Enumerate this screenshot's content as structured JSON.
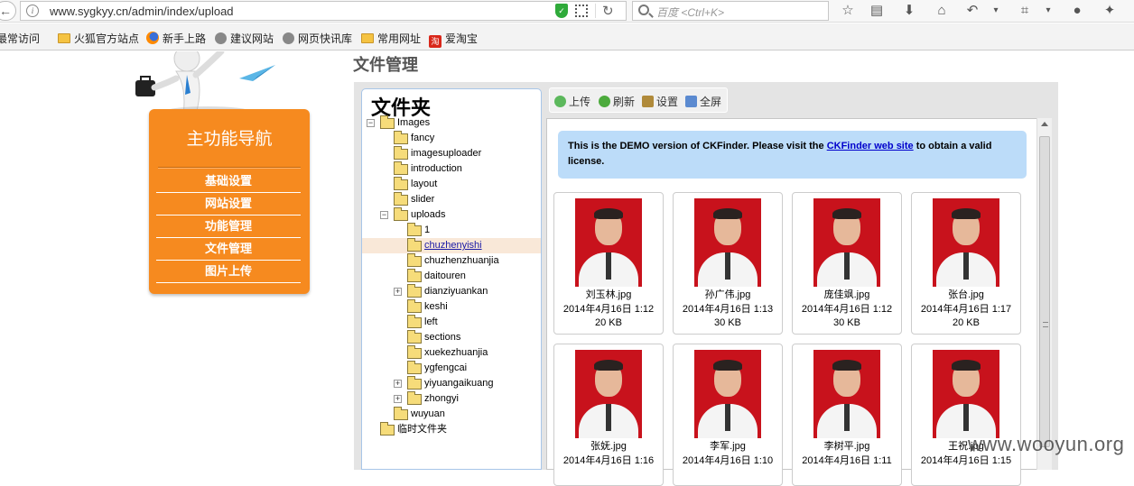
{
  "browser": {
    "url": "www.sygkyy.cn/admin/index/upload",
    "search_placeholder": "百度 <Ctrl+K>",
    "bookmarks": [
      "最常访问",
      "火狐官方站点",
      "新手上路",
      "建议网站",
      "网页快讯库",
      "常用网址",
      "爱淘宝"
    ]
  },
  "nav": {
    "title": "主功能导航",
    "items": [
      "基础设置",
      "网站设置",
      "功能管理",
      "文件管理",
      "图片上传"
    ]
  },
  "page": {
    "title": "文件管理"
  },
  "ckfinder": {
    "folders_heading": "文件夹",
    "toolbar": [
      "上传",
      "刷新",
      "设置",
      "全屏"
    ],
    "notice": {
      "before": "This is the DEMO version of CKFinder. Please visit the ",
      "link": "CKFinder web site",
      "after": " to obtain a valid license."
    },
    "tree": [
      {
        "label": "Images",
        "toggle": "−"
      },
      {
        "label": "fancy"
      },
      {
        "label": "imagesuploader"
      },
      {
        "label": "introduction"
      },
      {
        "label": "layout"
      },
      {
        "label": "slider"
      },
      {
        "label": "uploads",
        "toggle": "−"
      },
      {
        "label": "1"
      },
      {
        "label": "chuzhenyishi",
        "selected": true
      },
      {
        "label": "chuzhenzhuanjia"
      },
      {
        "label": "daitouren"
      },
      {
        "label": "dianziyuankan",
        "toggle": "+"
      },
      {
        "label": "keshi"
      },
      {
        "label": "left"
      },
      {
        "label": "sections"
      },
      {
        "label": "xuekezhuanjia"
      },
      {
        "label": "ygfengcai"
      },
      {
        "label": "yiyuangaikuang",
        "toggle": "+"
      },
      {
        "label": "zhongyi",
        "toggle": "+"
      },
      {
        "label": "wuyuan"
      },
      {
        "label": "临时文件夹"
      }
    ],
    "files": [
      {
        "name": "刘玉林.jpg",
        "date": "2014年4月16日 1:12",
        "size": "20 KB"
      },
      {
        "name": "孙广伟.jpg",
        "date": "2014年4月16日 1:13",
        "size": "30 KB"
      },
      {
        "name": "庞佳飒.jpg",
        "date": "2014年4月16日 1:12",
        "size": "30 KB"
      },
      {
        "name": "张台.jpg",
        "date": "2014年4月16日 1:17",
        "size": "20 KB"
      },
      {
        "name": "张妩.jpg",
        "date": "2014年4月16日 1:16",
        "size": ""
      },
      {
        "name": "李军.jpg",
        "date": "2014年4月16日 1:10",
        "size": ""
      },
      {
        "name": "李树平.jpg",
        "date": "2014年4月16日 1:11",
        "size": ""
      },
      {
        "name": "王祝.jpg",
        "date": "2014年4月16日 1:15",
        "size": ""
      }
    ]
  },
  "watermark": "www.wooyun.org"
}
